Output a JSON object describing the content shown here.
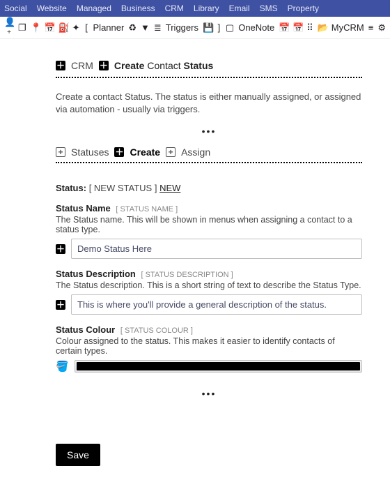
{
  "nav": {
    "items": [
      "Social",
      "Website",
      "Managed",
      "Business",
      "CRM",
      "Library",
      "Email",
      "SMS",
      "Property"
    ]
  },
  "toolbar": {
    "planner": "Planner",
    "triggers": "Triggers",
    "onenote": "OneNote",
    "mycrm": "MyCRM"
  },
  "breadcrumb": {
    "crm": "CRM",
    "create": "Create",
    "middle": "Contact",
    "tail": "Status"
  },
  "page": {
    "description": "Create a contact Status. The status is either manually assigned, or assigned via automation - usually via triggers.",
    "ellipsis": "•••"
  },
  "tabs": {
    "statuses": "Statuses",
    "create": "Create",
    "assign": "Assign"
  },
  "status_header": {
    "label": "Status:",
    "bracket": "[ NEW STATUS ]",
    "link": "NEW"
  },
  "fields": {
    "name": {
      "label": "Status Name",
      "token": "[ STATUS NAME ]",
      "help": "The Status name. This will be shown in menus when assigning a contact to a status type.",
      "value": "Demo Status Here"
    },
    "description": {
      "label": "Status Description",
      "token": "[ STATUS DESCRIPTION ]",
      "help": "The Status description. This is a short string of text to describe the Status Type.",
      "value": "This is where you'll provide a general description of the status."
    },
    "colour": {
      "label": "Status Colour",
      "token": "[ STATUS COLOUR ]",
      "help": "Colour assigned to the status. This makes it easier to identify contacts of certain types.",
      "value": "#000000"
    }
  },
  "actions": {
    "save": "Save"
  }
}
